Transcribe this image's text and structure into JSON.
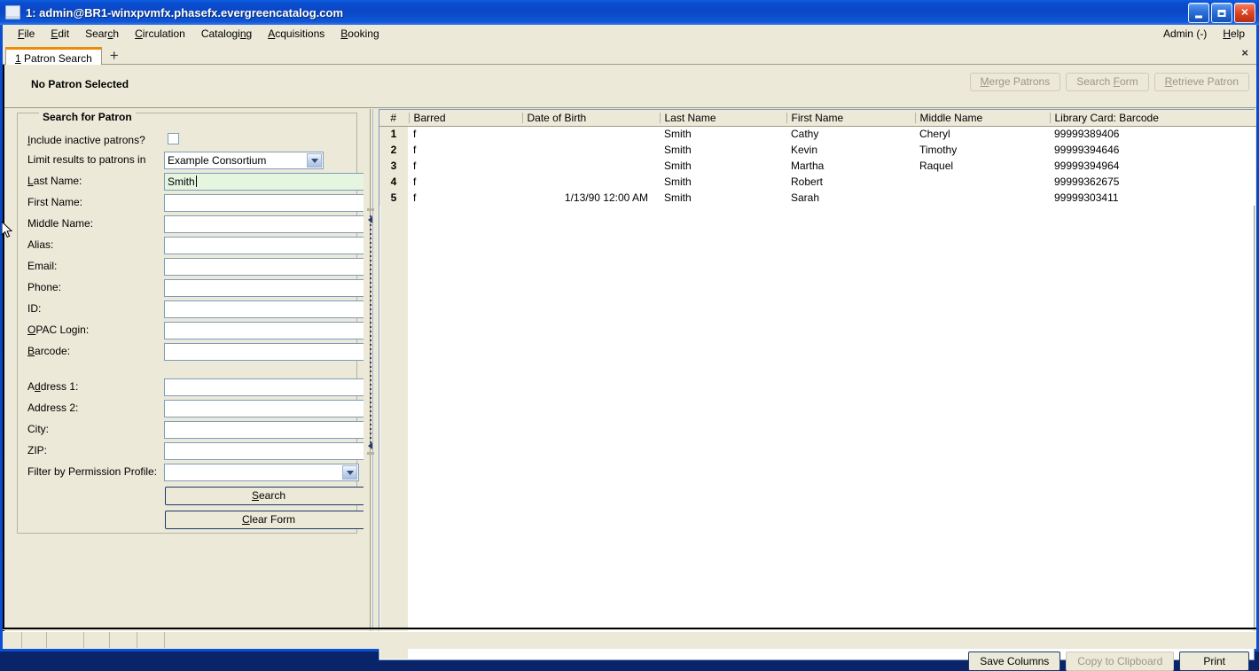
{
  "window": {
    "title": "1: admin@BR1-winxpvmfx.phasefx.evergreencatalog.com",
    "icon": "window-icon",
    "buttons": {
      "minimize": "minimize-icon",
      "maximize": "maximize-icon",
      "close": "close-icon"
    }
  },
  "menubar": {
    "items": [
      {
        "label": "File",
        "mnemonic": "F"
      },
      {
        "label": "Edit",
        "mnemonic": "E"
      },
      {
        "label": "Search",
        "mnemonic": "c"
      },
      {
        "label": "Circulation",
        "mnemonic": "C"
      },
      {
        "label": "Cataloging",
        "mnemonic": "n"
      },
      {
        "label": "Acquisitions",
        "mnemonic": "A"
      },
      {
        "label": "Booking",
        "mnemonic": "B"
      }
    ],
    "right": [
      {
        "label": "Admin (-)"
      },
      {
        "label": "Help",
        "mnemonic": "H"
      }
    ]
  },
  "tabbar": {
    "tabs": [
      {
        "number": "1",
        "label": "Patron Search",
        "active": true
      }
    ],
    "new_tab_label": "+",
    "close_label": "×"
  },
  "patron_bar": {
    "status": "No Patron Selected",
    "buttons": [
      {
        "label": "Merge Patrons",
        "enabled": false
      },
      {
        "label": "Search Form",
        "enabled": false
      },
      {
        "label": "Retrieve Patron",
        "enabled": false
      }
    ]
  },
  "search_form": {
    "legend": "Search for Patron",
    "include_inactive": {
      "label": "Include inactive patrons?",
      "checked": false
    },
    "limit_results": {
      "label": "Limit results to patrons in",
      "value": "Example Consortium"
    },
    "fields": [
      {
        "label": "Last Name:",
        "value": "Smith",
        "focused": true
      },
      {
        "label": "First Name:",
        "value": ""
      },
      {
        "label": "Middle Name:",
        "value": ""
      },
      {
        "label": "Alias:",
        "value": ""
      },
      {
        "label": "Email:",
        "value": ""
      },
      {
        "label": "Phone:",
        "value": ""
      },
      {
        "label": "ID:",
        "value": ""
      },
      {
        "label": "OPAC Login:",
        "value": ""
      },
      {
        "label": "Barcode:",
        "value": ""
      }
    ],
    "address_fields": [
      {
        "label": "Address 1:",
        "value": ""
      },
      {
        "label": "Address 2:",
        "value": ""
      },
      {
        "label": "City:",
        "value": ""
      },
      {
        "label": "ZIP:",
        "value": ""
      }
    ],
    "permission_profile": {
      "label": "Filter by Permission Profile:",
      "value": ""
    },
    "search_button": "Search",
    "clear_button": "Clear Form"
  },
  "results": {
    "columns": [
      "#",
      "Barred",
      "Date of Birth",
      "Last Name",
      "First Name",
      "Middle Name",
      "Library Card: Barcode"
    ],
    "column_picker_icon": "column-picker-icon",
    "rows": [
      {
        "num": "1",
        "barred": "f",
        "dob": "",
        "last": "Smith",
        "first": "Cathy",
        "middle": "Cheryl",
        "barcode": "99999389406"
      },
      {
        "num": "2",
        "barred": "f",
        "dob": "",
        "last": "Smith",
        "first": "Kevin",
        "middle": "Timothy",
        "barcode": "99999394646"
      },
      {
        "num": "3",
        "barred": "f",
        "dob": "",
        "last": "Smith",
        "first": "Martha",
        "middle": "Raquel",
        "barcode": "99999394964"
      },
      {
        "num": "4",
        "barred": "f",
        "dob": "",
        "last": "Smith",
        "first": "Robert",
        "middle": "",
        "barcode": "99999362675"
      },
      {
        "num": "5",
        "barred": "f",
        "dob": "1/13/90 12:00 AM",
        "last": "Smith",
        "first": "Sarah",
        "middle": "",
        "barcode": "99999303411"
      }
    ],
    "buttons": [
      {
        "label": "Save Columns",
        "enabled": true
      },
      {
        "label": "Copy to Clipboard",
        "enabled": false
      },
      {
        "label": "Print",
        "enabled": true
      }
    ]
  },
  "statusbar": {
    "segments": [
      "",
      "",
      "",
      "",
      "",
      "",
      ""
    ]
  },
  "colors": {
    "title_blue": "#0a4ed0",
    "face": "#ece9d8",
    "field_border": "#7f9db9",
    "focused_field": "#e4f5e0",
    "tab_accent": "#f08a00"
  }
}
